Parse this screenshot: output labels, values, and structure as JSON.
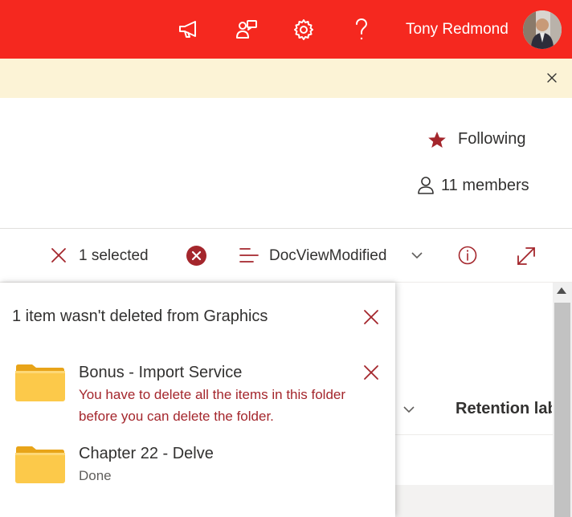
{
  "suite_bar": {
    "background": "#f5281f",
    "icons": [
      "megaphone-icon",
      "feedback-icon",
      "gear-icon",
      "help-icon"
    ],
    "user_name": "Tony Redmond"
  },
  "notice_bar": {
    "background": "#fcf3d6",
    "close_icon": "close-icon"
  },
  "site_header": {
    "following_label": "Following",
    "members_label": "11 members"
  },
  "command_bar": {
    "selection_label": "1 selected",
    "view_label": "DocViewModified"
  },
  "list": {
    "column_header": "Retention lab"
  },
  "error_panel": {
    "title": "1 item wasn't deleted from Graphics",
    "items": [
      {
        "name": "Bonus - Import Service",
        "status": "You have to delete all the items in this folder before you can delete the folder."
      },
      {
        "name": "Chapter 22 - Delve",
        "status": "Done"
      }
    ]
  },
  "colors": {
    "accent_red": "#a4262c",
    "star": "#a4262c",
    "folder": "#f8c84a"
  }
}
